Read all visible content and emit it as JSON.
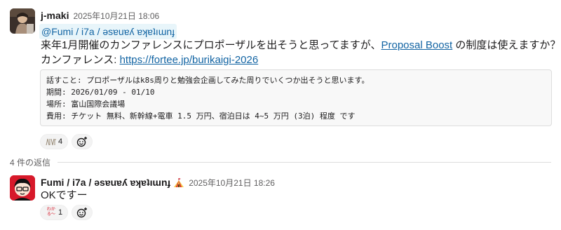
{
  "message1": {
    "author": "j-maki",
    "timestamp": "2025年10月21日 18:06",
    "mention": "@Fumi / i7a / ǝsɐuɐʎ ɐʞɐʇıɯnɟ",
    "text_line1_prefix": "来年1月開催のカンファレンスにプロポーザルを出そうと思ってますが、",
    "text_line1_link": "Proposal Boost",
    "text_line1_suffix": " の制度は使えますか？",
    "text_line2_prefix": "カンファレンス: ",
    "text_line2_link": "https://fortee.jp/burikaigi-2026",
    "code_lines": [
      "話すこと: プロポーザルはk8s周りと勉強会企画してみた周りでいくつか出そうと思います。",
      "期間: 2026/01/09 - 01/10",
      "場所: 富山国際会議場",
      "費用: チケット 無料、新幹線+電車 1.5 万円、宿泊日は 4~5 万円 (3泊) 程度 です"
    ],
    "reaction_count": "4"
  },
  "thread": {
    "reply_count_label": "4 件の返信"
  },
  "message2": {
    "author": "Fumi / i7a / ǝsɐuɐʎ ɐʞɐʇıɯnɟ",
    "timestamp": "2025年10月21日 18:26",
    "text": "OKですー",
    "reaction_count": "1",
    "reaction_emoji_text": "わかる〜"
  },
  "colors": {
    "link": "#1264a3",
    "mention_bg": "#e8f5fa",
    "avatar2_bg": "#d7192a"
  }
}
